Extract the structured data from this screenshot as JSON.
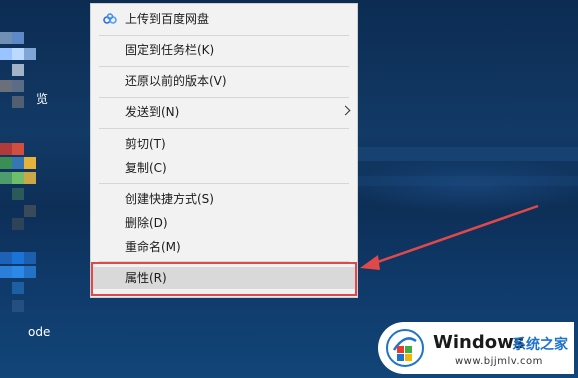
{
  "desktop": {
    "icon_labels": [
      "览",
      "ode"
    ]
  },
  "context_menu": {
    "items": [
      {
        "label": "上传到百度网盘",
        "icon": "baidu-cloud-icon"
      },
      {
        "label": "固定到任务栏(K)"
      },
      {
        "label": "还原以前的版本(V)"
      },
      {
        "label": "发送到(N)",
        "submenu": true
      },
      {
        "label": "剪切(T)"
      },
      {
        "label": "复制(C)"
      },
      {
        "label": "创建快捷方式(S)"
      },
      {
        "label": "删除(D)"
      },
      {
        "label": "重命名(M)"
      },
      {
        "label": "属性(R)",
        "highlighted": true
      }
    ]
  },
  "annotation": {
    "color": "#e0484a"
  },
  "watermark": {
    "title": "Windows",
    "cn_text": "系统之家",
    "url": "www.bjjmlv.com"
  }
}
